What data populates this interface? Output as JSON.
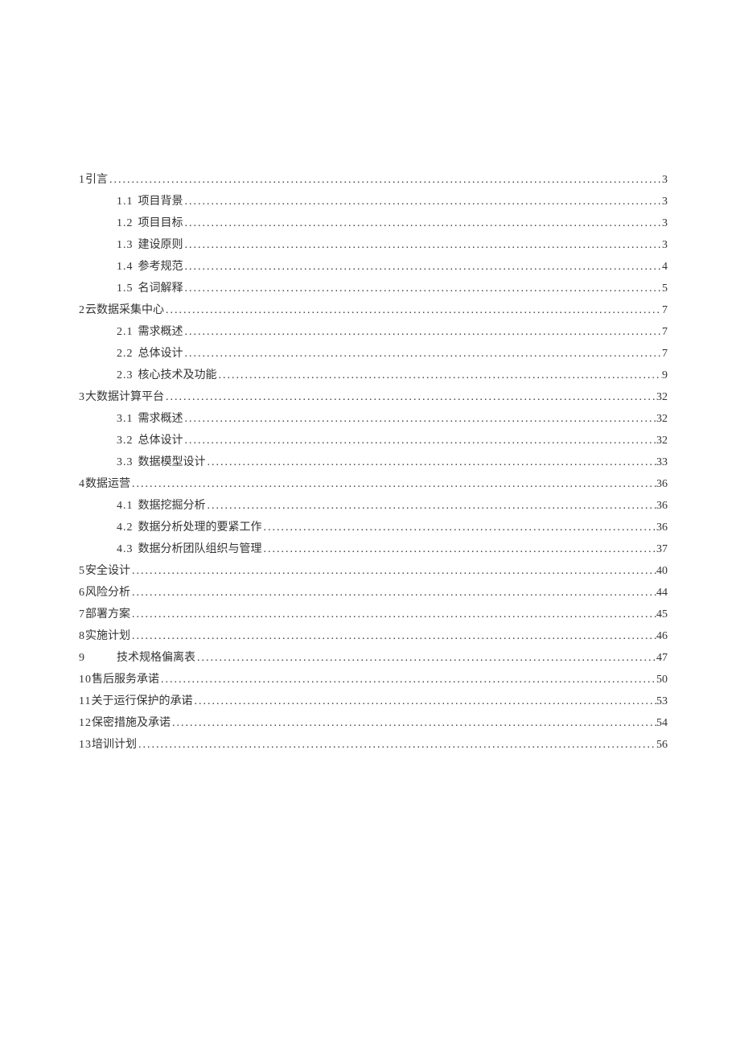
{
  "toc": [
    {
      "level": 1,
      "num": "1",
      "title": "引言",
      "page": "3"
    },
    {
      "level": 2,
      "num": "1.1",
      "title": "项目背景",
      "page": "3"
    },
    {
      "level": 2,
      "num": "1.2",
      "title": "项目目标",
      "page": "3"
    },
    {
      "level": 2,
      "num": "1.3",
      "title": "建设原则",
      "page": "3"
    },
    {
      "level": 2,
      "num": "1.4",
      "title": "参考规范",
      "page": "4"
    },
    {
      "level": 2,
      "num": "1.5",
      "title": "名词解释",
      "page": "5"
    },
    {
      "level": 1,
      "num": "2",
      "title": "云数据采集中心",
      "page": "7"
    },
    {
      "level": 2,
      "num": "2.1",
      "title": "需求概述",
      "page": "7"
    },
    {
      "level": 2,
      "num": "2.2",
      "title": "总体设计",
      "page": "7"
    },
    {
      "level": 2,
      "num": "2.3",
      "title": "核心技术及功能",
      "page": "9"
    },
    {
      "level": 1,
      "num": "3",
      "title": "大数据计算平台",
      "page": "32"
    },
    {
      "level": 2,
      "num": "3.1",
      "title": "需求概述",
      "page": "32"
    },
    {
      "level": 2,
      "num": "3.2",
      "title": "总体设计",
      "page": "32"
    },
    {
      "level": 2,
      "num": "3.3",
      "title": "数据模型设计",
      "page": "33"
    },
    {
      "level": 1,
      "num": "4",
      "title": "数据运营",
      "page": "36"
    },
    {
      "level": 2,
      "num": "4.1",
      "title": "数据挖掘分析",
      "page": "36"
    },
    {
      "level": 2,
      "num": "4.2",
      "title": "数据分析处理的要紧工作",
      "page": "36"
    },
    {
      "level": 2,
      "num": "4.3",
      "title": "数据分析团队组织与管理",
      "page": "37"
    },
    {
      "level": 1,
      "num": "5",
      "title": "安全设计",
      "page": "40"
    },
    {
      "level": 1,
      "num": "6",
      "title": "风险分析",
      "page": "44"
    },
    {
      "level": 1,
      "num": "7",
      "title": "部署方案",
      "page": "45"
    },
    {
      "level": 1,
      "num": "8",
      "title": "实施计划",
      "page": "46"
    },
    {
      "level": 1,
      "num": "9",
      "title": "技术规格偏离表",
      "page": "47",
      "spaced": true
    },
    {
      "level": 1,
      "num": "10",
      "title": "售后服务承诺",
      "page": "50"
    },
    {
      "level": 1,
      "num": "11",
      "title": "关于运行保护的承诺",
      "page": "53"
    },
    {
      "level": 1,
      "num": "12",
      "title": "保密措施及承诺",
      "page": "54"
    },
    {
      "level": 1,
      "num": "13",
      "title": "培训计划",
      "page": "56"
    }
  ]
}
